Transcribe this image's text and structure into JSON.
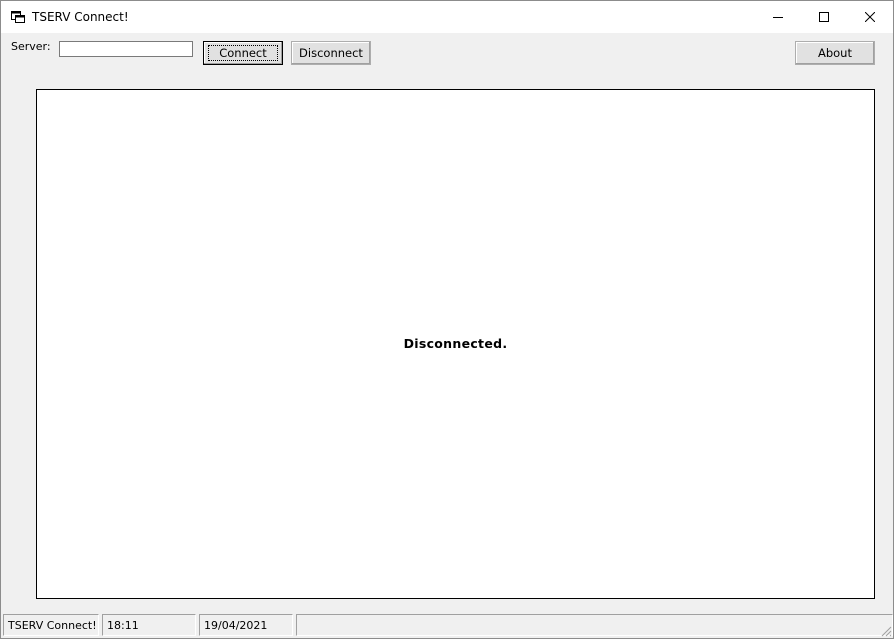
{
  "window": {
    "title": "TSERV Connect!"
  },
  "toolbar": {
    "server_label": "Server:",
    "server_value": "",
    "connect_label": "Connect",
    "disconnect_label": "Disconnect",
    "about_label": "About"
  },
  "content": {
    "message": "Disconnected."
  },
  "statusbar": {
    "app_name": "TSERV Connect!",
    "time": "18:11",
    "date": "19/04/2021",
    "extra": ""
  },
  "icons": {
    "app": "app-window-icon",
    "minimize": "minimize-icon",
    "maximize": "maximize-icon",
    "close": "close-icon",
    "grip": "resize-grip-icon"
  },
  "colors": {
    "window_bg": "#f0f0f0",
    "titlebar_bg": "#ffffff",
    "content_bg": "#ffffff",
    "button_bg": "#e1e1e1"
  }
}
